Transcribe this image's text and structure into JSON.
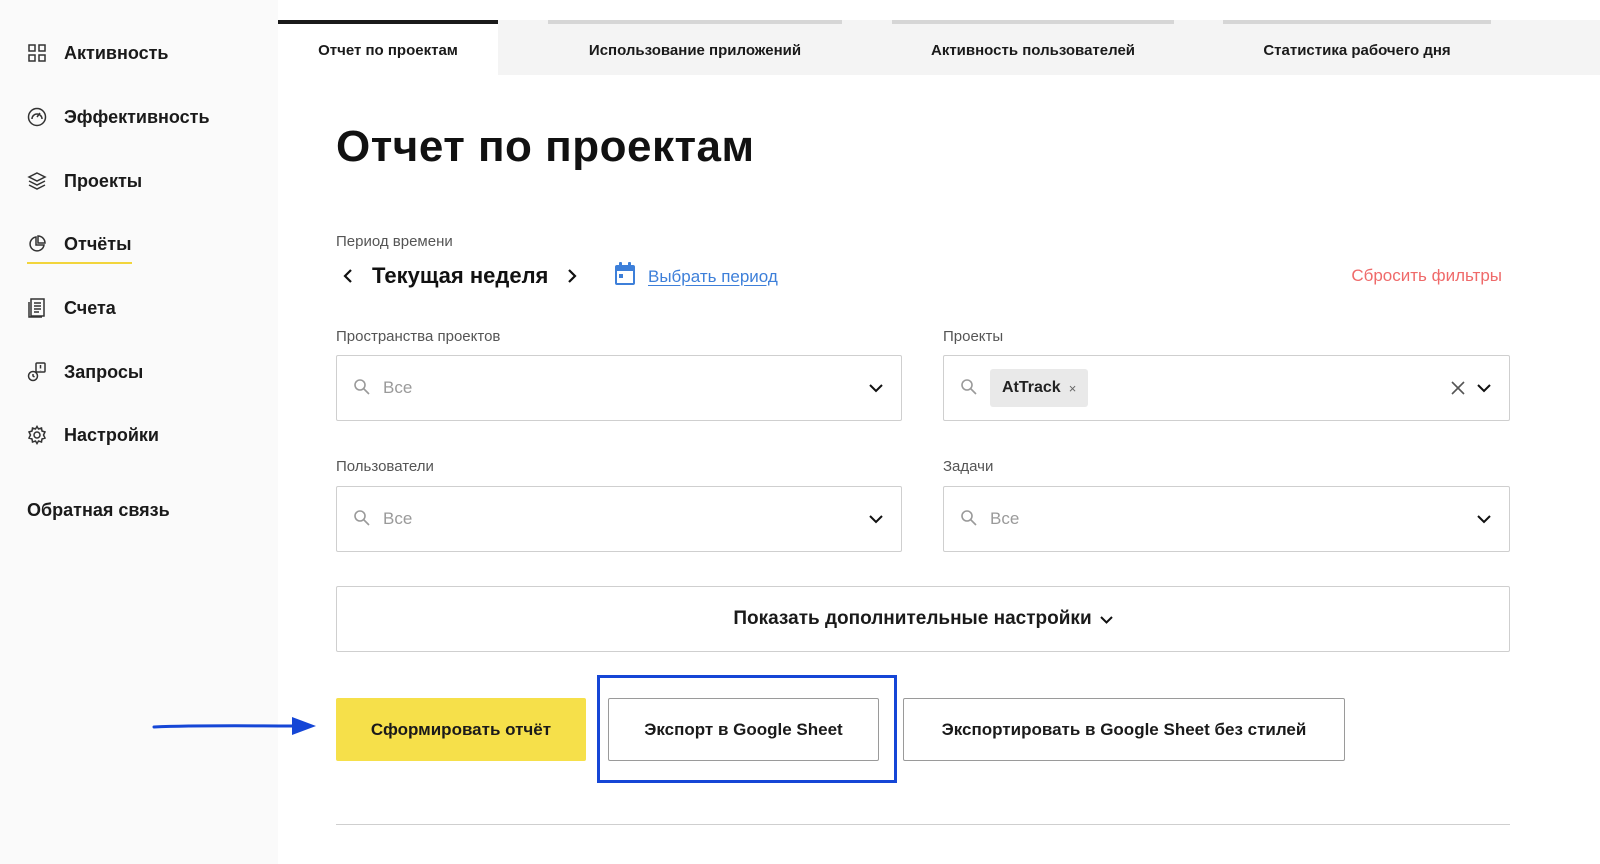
{
  "sidebar": {
    "items": [
      {
        "label": "Активность",
        "icon": "grid-icon"
      },
      {
        "label": "Эффективность",
        "icon": "gauge-icon"
      },
      {
        "label": "Проекты",
        "icon": "layers-icon"
      },
      {
        "label": "Отчёты",
        "icon": "pie-chart-icon",
        "active": true
      },
      {
        "label": "Счета",
        "icon": "invoice-icon"
      },
      {
        "label": "Запросы",
        "icon": "request-icon"
      },
      {
        "label": "Настройки",
        "icon": "gear-icon"
      }
    ],
    "feedback": "Обратная связь"
  },
  "tabs": [
    {
      "label": "Отчет по проектам",
      "active": true
    },
    {
      "label": "Использование приложений"
    },
    {
      "label": "Активность пользователей"
    },
    {
      "label": "Статистика рабочего дня"
    }
  ],
  "page": {
    "title": "Отчет по проектам"
  },
  "filters": {
    "period_label": "Период времени",
    "period_value": "Текущая неделя",
    "pick_period": "Выбрать период",
    "reset": "Сбросить фильтры",
    "spaces": {
      "label": "Пространства проектов",
      "placeholder": "Все"
    },
    "projects": {
      "label": "Проекты",
      "chip": "AtTrack",
      "chip_remove": "×"
    },
    "users": {
      "label": "Пользователи",
      "placeholder": "Все"
    },
    "tasks": {
      "label": "Задачи",
      "placeholder": "Все"
    }
  },
  "actions": {
    "more_settings": "Показать дополнительные настройки",
    "generate": "Сформировать отчёт",
    "export_sheet": "Экспорт в Google Sheet",
    "export_plain": "Экспортировать в Google Sheet без стилей"
  },
  "colors": {
    "accent_yellow": "#f6e04a",
    "link_blue": "#3d7fd9",
    "reset_red": "#ef6a6a",
    "highlight_blue": "#1546d6"
  }
}
